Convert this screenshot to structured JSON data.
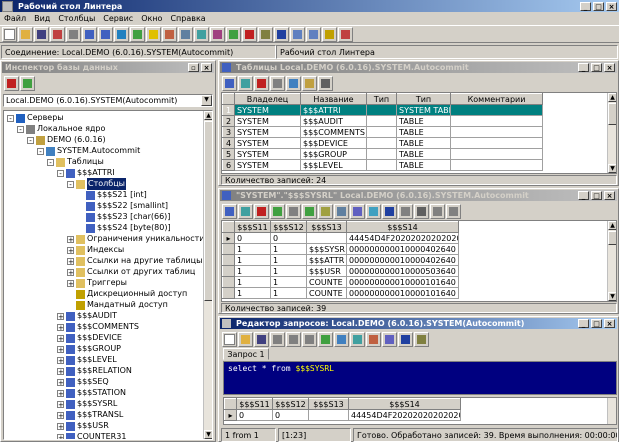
{
  "app": {
    "title": "Рабочий стол Линтера",
    "menu": [
      "Файл",
      "Вид",
      "Столбцы",
      "Сервис",
      "Окно",
      "Справка"
    ]
  },
  "status_top": {
    "connection": "Соединение: Local.DEMO  (6.0.16).SYSTEM(Autocommit)",
    "desktop": "Рабочий стол Линтера"
  },
  "inspector": {
    "title": "Инспектор базы данных",
    "connection_select": "Local.DEMO (6.0.16).SYSTEM(Autocommit)",
    "tree": [
      {
        "label": "Серверы",
        "level": 0,
        "pm": "-",
        "icon": "globe"
      },
      {
        "label": "Локальное ядро",
        "level": 1,
        "pm": "-",
        "icon": "server"
      },
      {
        "label": "DEMO (6.0.16)",
        "level": 2,
        "pm": "-",
        "icon": "db"
      },
      {
        "label": "SYSTEM.Autocommit",
        "level": 3,
        "pm": "-",
        "icon": "user"
      },
      {
        "label": "Таблицы",
        "level": 4,
        "pm": "-",
        "icon": "folder"
      },
      {
        "label": "$$$ATTRI",
        "level": 5,
        "pm": "-",
        "icon": "table"
      },
      {
        "label": "Столбцы",
        "level": 6,
        "pm": "-",
        "icon": "folder",
        "selected": true
      },
      {
        "label": "$$$S21 [int]",
        "level": 7,
        "pm": "",
        "icon": "col"
      },
      {
        "label": "$$$S22 [smallint]",
        "level": 7,
        "pm": "",
        "icon": "col"
      },
      {
        "label": "$$$S23 [char(66)]",
        "level": 7,
        "pm": "",
        "icon": "col"
      },
      {
        "label": "$$$S24 [byte(80)]",
        "level": 7,
        "pm": "",
        "icon": "col"
      },
      {
        "label": "Ограничения уникальности",
        "level": 6,
        "pm": "+",
        "icon": "folder"
      },
      {
        "label": "Индексы",
        "level": 6,
        "pm": "+",
        "icon": "folder"
      },
      {
        "label": "Ссылки на другие таблицы",
        "level": 6,
        "pm": "+",
        "icon": "folder"
      },
      {
        "label": "Ссылки от других таблиц",
        "level": 6,
        "pm": "+",
        "icon": "folder"
      },
      {
        "label": "Триггеры",
        "level": 6,
        "pm": "+",
        "icon": "folder"
      },
      {
        "label": "Дискреционный доступ",
        "level": 6,
        "pm": "",
        "icon": "key"
      },
      {
        "label": "Мандатный доступ",
        "level": 6,
        "pm": "",
        "icon": "key"
      },
      {
        "label": "$$$AUDIT",
        "level": 5,
        "pm": "+",
        "icon": "table"
      },
      {
        "label": "$$$COMMENTS",
        "level": 5,
        "pm": "+",
        "icon": "table"
      },
      {
        "label": "$$$DEVICE",
        "level": 5,
        "pm": "+",
        "icon": "table"
      },
      {
        "label": "$$$GROUP",
        "level": 5,
        "pm": "+",
        "icon": "table"
      },
      {
        "label": "$$$LEVEL",
        "level": 5,
        "pm": "+",
        "icon": "table"
      },
      {
        "label": "$$$RELATION",
        "level": 5,
        "pm": "+",
        "icon": "table"
      },
      {
        "label": "$$$SEQ",
        "level": 5,
        "pm": "+",
        "icon": "table"
      },
      {
        "label": "$$$STATION",
        "level": 5,
        "pm": "+",
        "icon": "table"
      },
      {
        "label": "$$$SYSRL",
        "level": 5,
        "pm": "+",
        "icon": "table"
      },
      {
        "label": "$$$TRANSL",
        "level": 5,
        "pm": "+",
        "icon": "table"
      },
      {
        "label": "$$$USR",
        "level": 5,
        "pm": "+",
        "icon": "table"
      },
      {
        "label": "COUNTER31",
        "level": 5,
        "pm": "+",
        "icon": "table"
      }
    ]
  },
  "tables_window": {
    "title": "Таблицы Local.DEMO (6.0.16).SYSTEM.Autocommit",
    "columns": [
      "Владелец",
      "Название",
      "Тип",
      "Тип",
      "Комментарии"
    ],
    "rows": [
      {
        "n": "1",
        "owner": "SYSTEM",
        "name": "$$$ATTRI",
        "t1": "",
        "t2": "SYSTEM TABLE",
        "comment": ""
      },
      {
        "n": "2",
        "owner": "SYSTEM",
        "name": "$$$AUDIT",
        "t1": "",
        "t2": "TABLE",
        "comment": ""
      },
      {
        "n": "3",
        "owner": "SYSTEM",
        "name": "$$$COMMENTS",
        "t1": "",
        "t2": "TABLE",
        "comment": ""
      },
      {
        "n": "4",
        "owner": "SYSTEM",
        "name": "$$$DEVICE",
        "t1": "",
        "t2": "TABLE",
        "comment": ""
      },
      {
        "n": "5",
        "owner": "SYSTEM",
        "name": "$$$GROUP",
        "t1": "",
        "t2": "TABLE",
        "comment": ""
      },
      {
        "n": "6",
        "owner": "SYSTEM",
        "name": "$$$LEVEL",
        "t1": "",
        "t2": "TABLE",
        "comment": ""
      }
    ],
    "count": "Количество записей: 24"
  },
  "data_window": {
    "title": "\"SYSTEM\".\"$$$SYSRL\" Local.DEMO (6.0.16).SYSTEM.Autocommit",
    "columns": [
      "$$$S11",
      "$$$S12",
      "$$$S13",
      "$$$S14"
    ],
    "rows": [
      {
        "n": "0",
        "a": "0",
        "b": "0",
        "c": "",
        "d": "44454D4F2020202020202020"
      },
      {
        "n": "1",
        "a": "1",
        "b": "1",
        "c": "$$$SYSR",
        "d": "000000000010000402640"
      },
      {
        "n": "2",
        "a": "1",
        "b": "1",
        "c": "$$$ATTR",
        "d": "000000000010000402640"
      },
      {
        "n": "3",
        "a": "1",
        "b": "1",
        "c": "$$$USR",
        "d": "000000000010000503640"
      },
      {
        "n": "4",
        "a": "1",
        "b": "1",
        "c": "COUNTE",
        "d": "000000000010000101640"
      },
      {
        "n": "5",
        "a": "1",
        "b": "1",
        "c": "COUNTE",
        "d": "000000000010000101640"
      }
    ],
    "count": "Количество записей: 39"
  },
  "query_window": {
    "title": "Редактор запросов: Local.DEMO (6.0.16).SYSTEM(Autocommit)",
    "tab": "Запрос 1",
    "sql_kw1": "select",
    "sql_mid": " * ",
    "sql_kw2": "from",
    "sql_table": " $$$SYSRL",
    "columns": [
      "$$$S11",
      "$$$S12",
      "$$$S13",
      "$$$S14"
    ],
    "row": {
      "n": "0",
      "a": "0",
      "b": "",
      "c": "",
      "d": "44454D4F2020202020202020"
    }
  },
  "statusbar": {
    "position": "1 from 1",
    "cursor": "[1:23]",
    "message": "Готово. Обработано записей: 39. Время выполнения: 00:00:00.00."
  },
  "colors": {
    "title_active": "#0a246a",
    "selection": "#008080",
    "sql_bg": "#000080",
    "sql_keyword": "#ffffff",
    "sql_table": "#ffff00"
  }
}
